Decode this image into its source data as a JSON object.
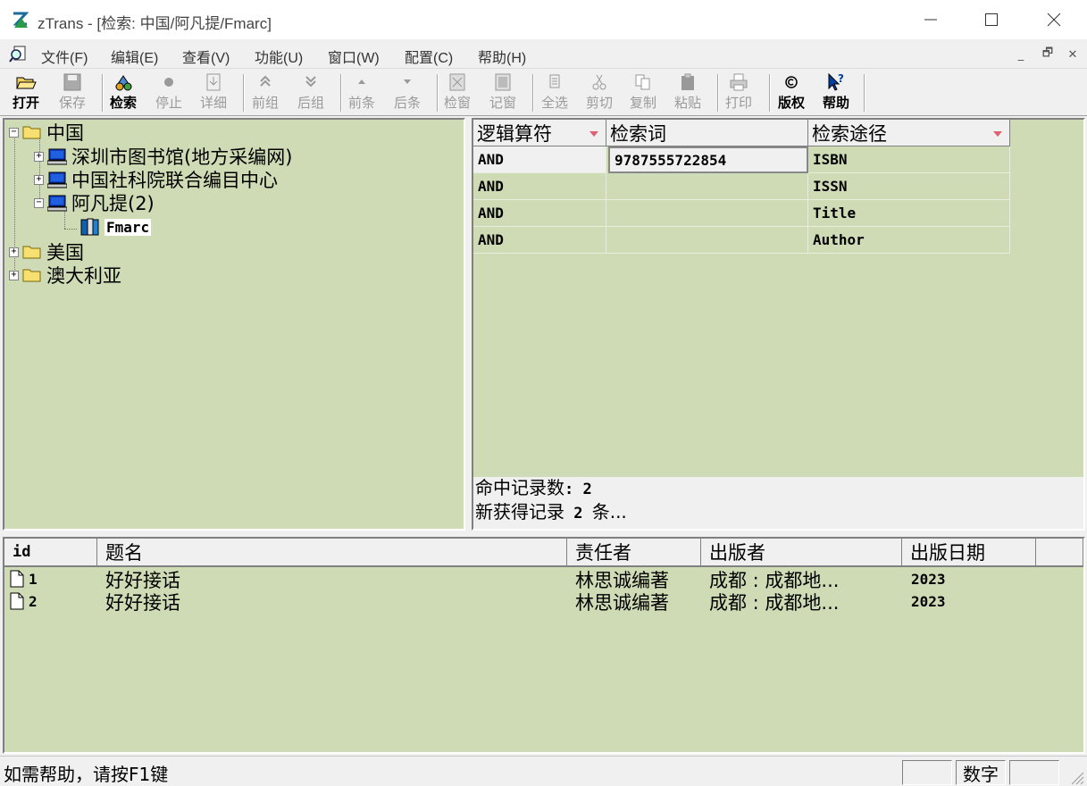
{
  "window": {
    "title": "zTrans - [检索: 中国/阿凡提/Fmarc]"
  },
  "menu": [
    "文件(F)",
    "编辑(E)",
    "查看(V)",
    "功能(U)",
    "窗口(W)",
    "配置(C)",
    "帮助(H)"
  ],
  "toolbar": {
    "open": "打开",
    "save": "保存",
    "search": "检索",
    "stop": "停止",
    "detail": "详细",
    "prev_group": "前组",
    "next_group": "后组",
    "prev_item": "前条",
    "next_item": "后条",
    "check_window": "检窗",
    "record_window": "记窗",
    "select_all": "全选",
    "cut": "剪切",
    "copy": "复制",
    "paste": "粘贴",
    "print": "打印",
    "copyright": "版权",
    "help": "帮助"
  },
  "tree": {
    "root1": "中国",
    "lib1": "深圳市图书馆(地方采编网)",
    "lib2": "中国社科院联合编目中心",
    "lib3": "阿凡提(2)",
    "db": "Fmarc",
    "root2": "美国",
    "root3": "澳大利亚"
  },
  "query": {
    "headers": [
      "逻辑算符",
      "检索词",
      "检索途径"
    ],
    "rows": [
      {
        "op": "AND",
        "term": "9787555722854",
        "field": "ISBN"
      },
      {
        "op": "AND",
        "term": "",
        "field": "ISSN"
      },
      {
        "op": "AND",
        "term": "",
        "field": "Title"
      },
      {
        "op": "AND",
        "term": "",
        "field": "Author"
      }
    ],
    "status_line1_label": "命中记录数",
    "status_line1_value": ": 2",
    "status_line2_a": "新获得记录",
    "status_line2_b": " 2 ",
    "status_line2_c": "条...",
    "status_line2_d": ""
  },
  "results": {
    "headers": [
      "id",
      "题名",
      "责任者",
      "出版者",
      "出版日期"
    ],
    "rows": [
      {
        "id": "1",
        "title": "好好接话",
        "author": "林思诚编著",
        "publisher": "成都 : 成都地...",
        "date": "2023"
      },
      {
        "id": "2",
        "title": "好好接话",
        "author": "林思诚编著",
        "publisher": "成都 : 成都地...",
        "date": "2023"
      }
    ]
  },
  "status": {
    "message": "如需帮助，请按F1键",
    "num": "数字"
  }
}
